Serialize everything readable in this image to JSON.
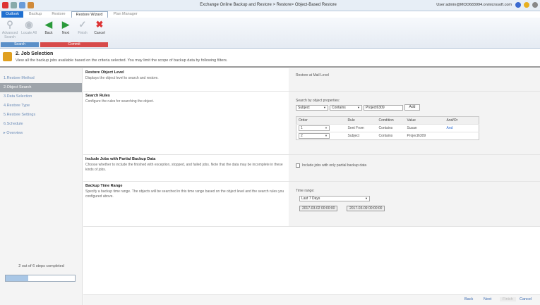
{
  "window": {
    "title": "Exchange Online Backup and Restore > Restore> Object-Based Restore",
    "user": "User:admin@MOD683994.onmicrosoft.com"
  },
  "ribbon_tabs": [
    "Outlook",
    "Backup",
    "Restore",
    "Restore Wizard",
    "Plan Manager"
  ],
  "ribbon": {
    "buttons": [
      {
        "label": "Advanced Search",
        "icon": "magnifier-icon",
        "enabled": false
      },
      {
        "label": "Locate All",
        "icon": "locate-icon",
        "enabled": false
      },
      {
        "label": "Back",
        "icon": "back-arrow-icon",
        "enabled": true
      },
      {
        "label": "Next",
        "icon": "next-arrow-icon",
        "enabled": true
      },
      {
        "label": "Finish",
        "icon": "finish-check-icon",
        "enabled": false
      },
      {
        "label": "Cancel",
        "icon": "cancel-x-icon",
        "enabled": true
      }
    ],
    "groups": {
      "search": "Search",
      "commit": "Commit"
    }
  },
  "step": {
    "title": "2. Job Selection",
    "description": "View all the backup jobs available based on the criteria selected. You may limit the scope of backup data by following filters."
  },
  "nav": {
    "items": [
      "1.Restore Method",
      "2.Object Search",
      "3.Data Selection",
      "4.Restore Type",
      "5.Restore Settings",
      "6.Schedule",
      "▸ Overview"
    ],
    "active_index": 1,
    "progress_text": "2 out of 6 steps completed",
    "progress_value": 0.33
  },
  "restore_level": {
    "title": "Restore Object Level",
    "description": "Displays the object level to search and restore.",
    "value": "Restore at Mail Level"
  },
  "search_rules": {
    "title": "Search Rules",
    "description": "Configure the rules for searching the object.",
    "prop_label": "Search by object properties:",
    "property": "Subject",
    "condition": "Contains",
    "value": "Project6309",
    "add_label": "Add",
    "columns": [
      "Order",
      "Rule",
      "Condition",
      "Value",
      "And/Or"
    ],
    "rows": [
      {
        "order": "1",
        "rule": "Sent From",
        "condition": "Contains",
        "value": "Susan",
        "andor": "And"
      },
      {
        "order": "2",
        "rule": "Subject",
        "condition": "Contains",
        "value": "Project6309",
        "andor": ""
      }
    ]
  },
  "partial_jobs": {
    "title": "Include Jobs with Partial Backup Data",
    "description": "Choose whether to include the finished with exception, stopped, and failed jobs. Note that the data may be incomplete in these kinds of jobs.",
    "checkbox_label": "Include jobs with only partial backup data",
    "checked": false
  },
  "time_range": {
    "title": "Backup Time Range",
    "description": "Specify a backup time range. The objects will be searched in this time range based on the object level and the search rules you configured above.",
    "label": "Time range:",
    "selected": "Last 7 Days",
    "start": "2017-03-02 00:00:00",
    "end": "2017-03-09 00:00:00"
  },
  "footer": {
    "back": "Back",
    "next": "Next",
    "finish": "Finish",
    "cancel": "Cancel"
  }
}
